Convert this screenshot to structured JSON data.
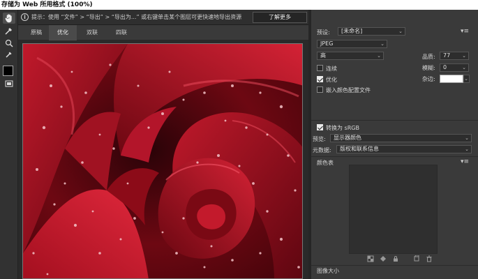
{
  "window": {
    "title": "存储为 Web 所用格式 (100%)"
  },
  "toolbar": {
    "tools": [
      "hand-icon",
      "slice-select-icon",
      "zoom-icon",
      "eyedropper-icon"
    ],
    "eyedropper_color": "#000000"
  },
  "infobar": {
    "hint": "提示：使用 “文件” > “导出” > “导出为...” 或右键单击某个图层可更快速地导出资源",
    "learn_more": "了解更多"
  },
  "tabs": [
    {
      "label": "原稿",
      "active": false
    },
    {
      "label": "优化",
      "active": true
    },
    {
      "label": "双联",
      "active": false
    },
    {
      "label": "四联",
      "active": false
    }
  ],
  "image": {
    "subject": "red-rose-with-water-droplets",
    "accent": "#9b0b18"
  },
  "settings": {
    "preset_label": "预设:",
    "preset_value": "[未命名]",
    "format": "JPEG",
    "quality_preset": "高",
    "quality_label": "品质:",
    "quality_value": "77",
    "progressive_label": "连续",
    "progressive_checked": false,
    "blur_label": "模糊:",
    "blur_value": "0",
    "optimized_label": "优化",
    "optimized_checked": true,
    "matte_label": "杂边:",
    "matte_color": "#ffffff",
    "embed_profile_label": "嵌入颜色配置文件",
    "embed_profile_checked": false,
    "convert_srgb_label": "转换为 sRGB",
    "convert_srgb_checked": true,
    "preview_label": "预览:",
    "preview_value": "显示器颜色",
    "metadata_label": "元数据:",
    "metadata_value": "版权和联系信息",
    "color_table_label": "颜色表",
    "image_size_label": "图像大小"
  }
}
